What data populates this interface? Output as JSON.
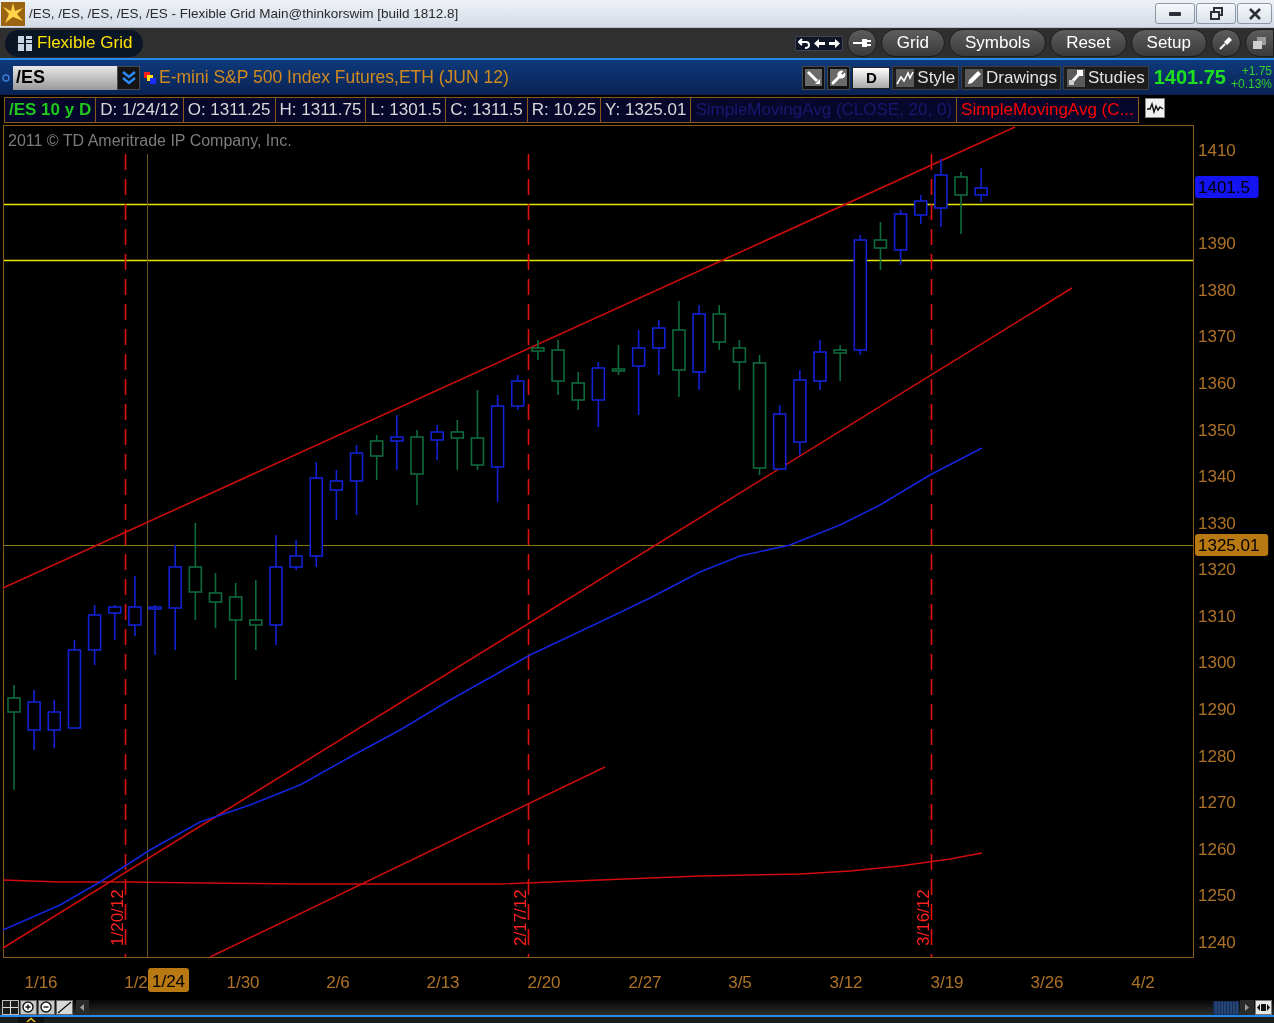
{
  "window": {
    "title": "/ES, /ES, /ES, /ES, /ES - Flexible Grid Main@thinkorswim [build 1812.8]"
  },
  "toolbar": {
    "workspace": "Flexible Grid",
    "buttons": [
      {
        "label": "Grid"
      },
      {
        "label": "Symbols"
      },
      {
        "label": "Reset"
      },
      {
        "label": "Setup"
      }
    ]
  },
  "symbol_bar": {
    "symbol": "/ES",
    "description": "E-mini S&P 500 Index Futures,ETH (JUN 12)",
    "aggregation": "D",
    "tools": [
      {
        "kind": "style",
        "label": "Style"
      },
      {
        "kind": "drawings",
        "label": "Drawings"
      },
      {
        "kind": "studies",
        "label": "Studies"
      }
    ],
    "last_price": "1401.75",
    "change": "+1.75",
    "change_percent": "+0.13%"
  },
  "info_bar": [
    {
      "kind": "symbol",
      "text": "/ES 10 y D"
    },
    {
      "kind": "field",
      "text": "D: 1/24/12"
    },
    {
      "kind": "field",
      "text": "O: 1311.25"
    },
    {
      "kind": "field",
      "text": "H: 1311.75"
    },
    {
      "kind": "field",
      "text": "L: 1301.5"
    },
    {
      "kind": "field",
      "text": "C: 1311.5"
    },
    {
      "kind": "field",
      "text": "R: 10.25"
    },
    {
      "kind": "field",
      "text": "Y: 1325.01"
    },
    {
      "kind": "study",
      "text": "SimpleMovingAvg (CLOSE, 20, 0)",
      "dimmed": true
    },
    {
      "kind": "study",
      "text": "SimpleMovingAvg (C...",
      "dimmed": false
    }
  ],
  "chart": {
    "copyright": "2011 © TD Ameritrade IP Company, Inc.",
    "price_labels": [
      "1410",
      "1390",
      "1380",
      "1370",
      "1360",
      "1350",
      "1340",
      "1330",
      "1320",
      "1310",
      "1300",
      "1290",
      "1280",
      "1270",
      "1260",
      "1250",
      "1240"
    ],
    "price_tags": [
      {
        "text": "1401.5",
        "color": "#1414f0"
      },
      {
        "text": "1325.01",
        "color": "#b87812"
      }
    ],
    "date_labels": [
      "1/16",
      "1/2",
      "1/30",
      "2/6",
      "2/13",
      "2/20",
      "2/27",
      "3/5",
      "3/12",
      "3/19",
      "3/26",
      "4/2"
    ],
    "date_tag": "1/24",
    "date_markers": [
      "1/20/12",
      "2/17/12",
      "3/16/12"
    ]
  }
}
